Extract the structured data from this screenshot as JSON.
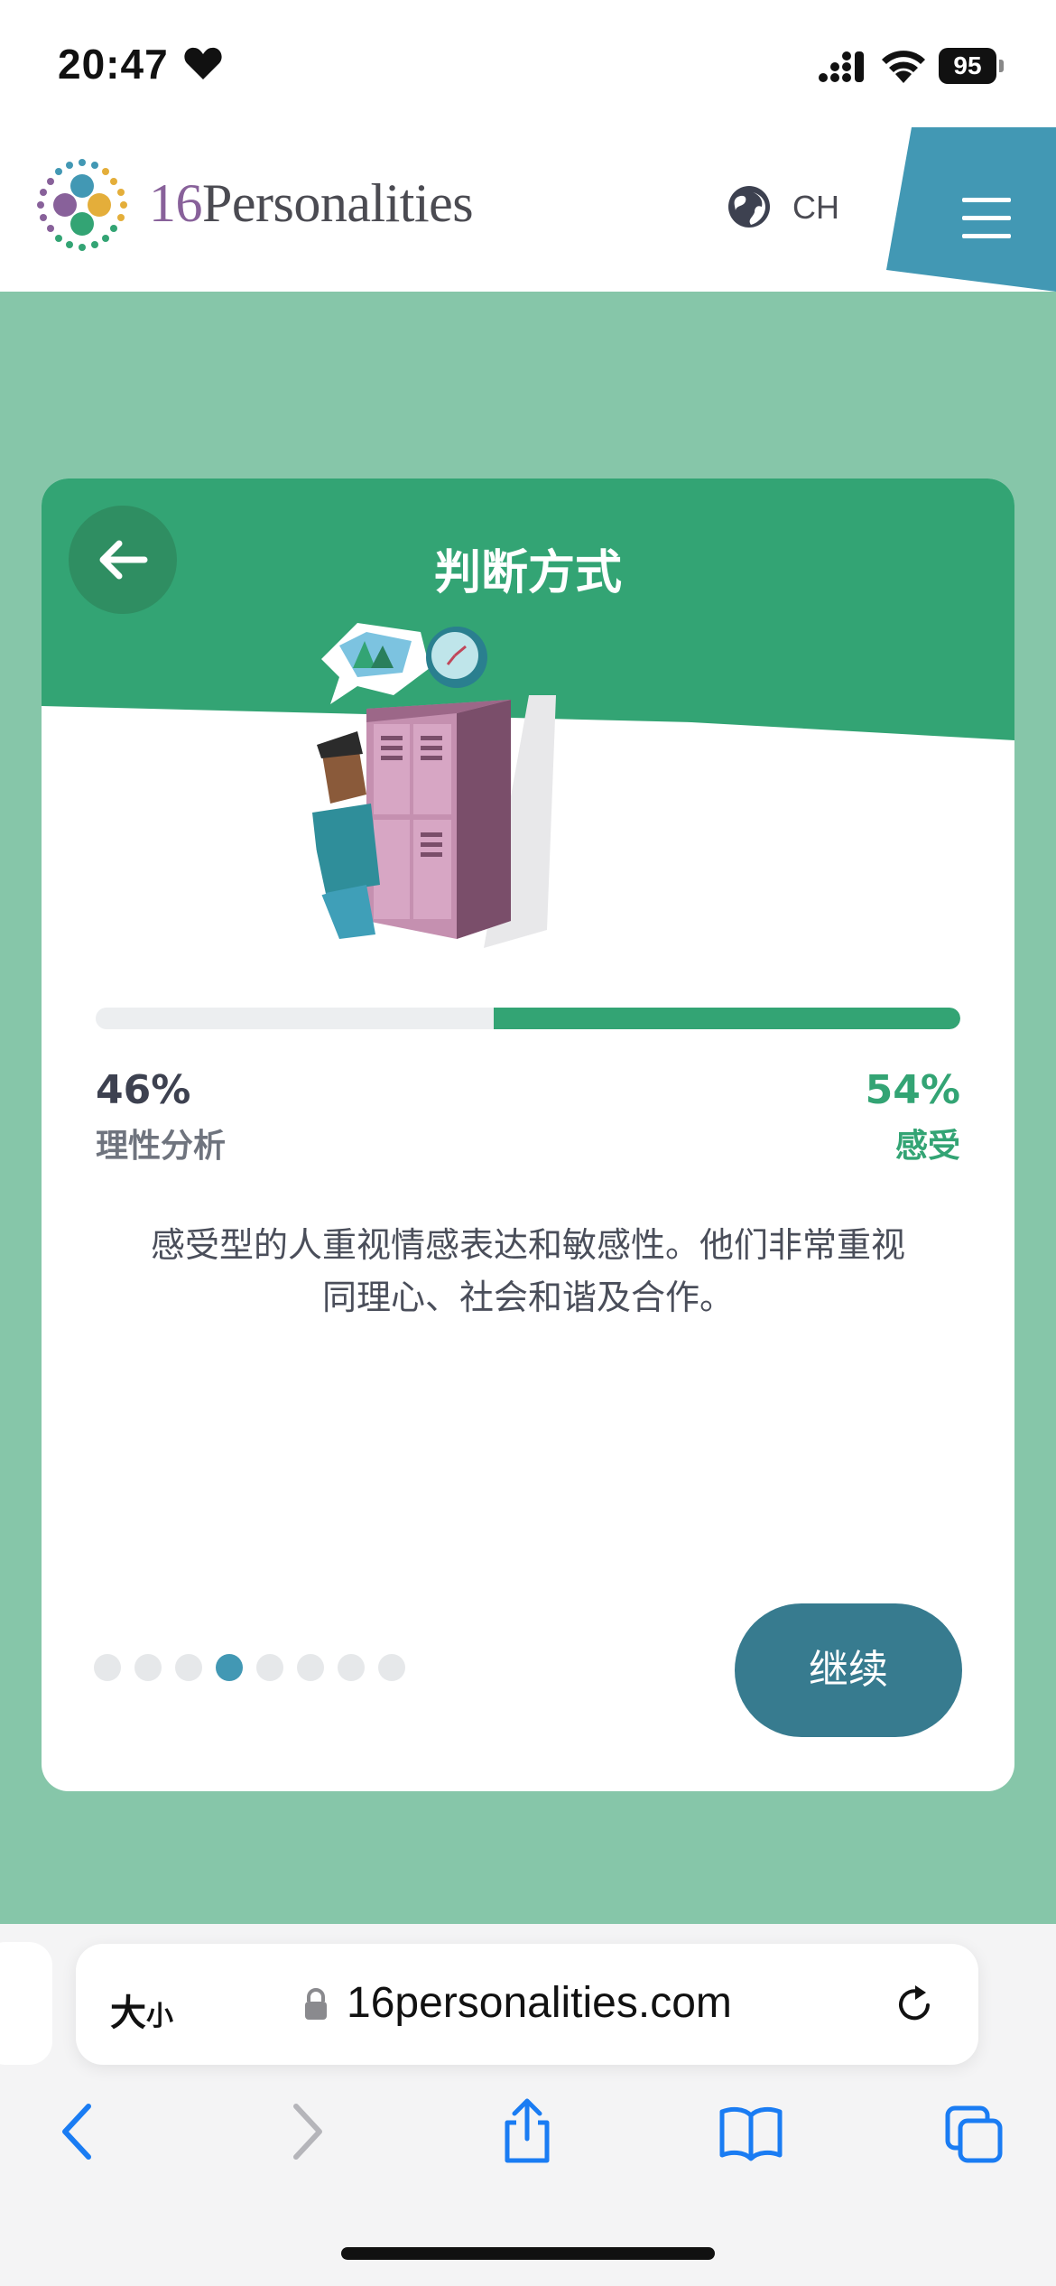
{
  "status_bar": {
    "time": "20:47",
    "battery": "95"
  },
  "header": {
    "logo_number": "16",
    "logo_word": "Personalities",
    "language": "CH"
  },
  "card": {
    "title": "判断方式",
    "left_percent": "46%",
    "left_label": "理性分析",
    "right_percent": "54%",
    "right_label": "感受",
    "right_fraction": 0.54,
    "description_line1": "感受型的人重视情感表达和敏感性。他们非常重视",
    "description_line2": "同理心、社会和谐及合作。",
    "continue_label": "继续",
    "dots_total": 8,
    "dots_active_index": 3
  },
  "browser": {
    "text_size_big": "大",
    "text_size_small": "小",
    "url": "16personalities.com"
  },
  "colors": {
    "page_bg": "#86c6a9",
    "card_header": "#33a474",
    "accent_green": "#33a474",
    "button": "#377b8f",
    "active_dot": "#4298b4",
    "menu_blue": "#4298b4"
  },
  "icons": [
    "heart-icon",
    "signal-icon",
    "wifi-icon",
    "battery-icon",
    "globe-icon",
    "hamburger-menu-icon",
    "back-arrow-icon",
    "lock-icon",
    "reload-icon",
    "back-chevron-icon",
    "forward-chevron-icon",
    "share-icon",
    "bookmarks-icon",
    "tabs-icon"
  ]
}
